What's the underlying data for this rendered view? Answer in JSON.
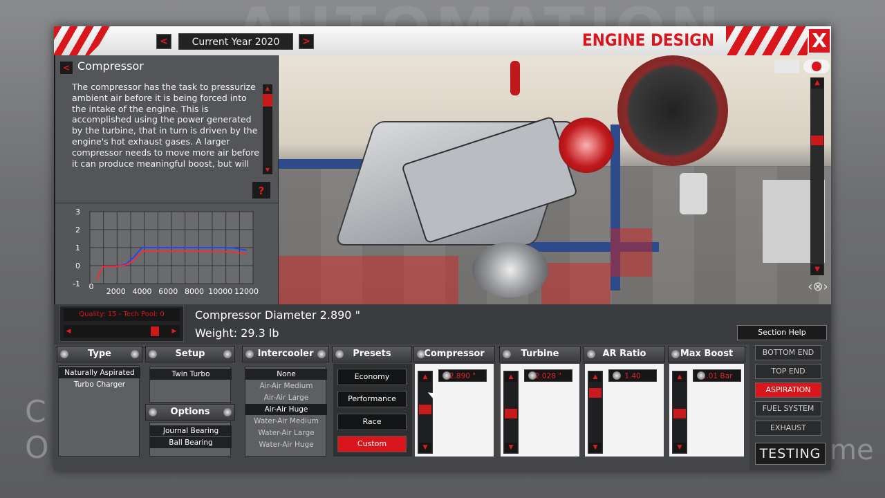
{
  "backdrop": {
    "title": "AUTOMATION",
    "left_text": "C\nO",
    "right_text": "me"
  },
  "header": {
    "year_label": "Current Year 2020",
    "prev_year": "<",
    "next_year": ">",
    "title": "ENGINE DESIGN",
    "close": "X"
  },
  "info": {
    "back": "<",
    "heading": "Compressor",
    "text": "The compressor has the task to pressurize ambient air before it is being forced into the intake of the engine. This is accomplished using the power generated by the turbine, that in turn is driven by the engine's hot exhaust gases. A larger compressor needs to move more air before it can produce meaningful boost, but will",
    "help": "?"
  },
  "chart_data": {
    "type": "line",
    "title": "",
    "xlabel": "",
    "ylabel": "",
    "x_ticks": [
      "2000",
      "4000",
      "6000",
      "8000",
      "10000",
      "12000"
    ],
    "y_ticks": [
      "3",
      "2",
      "1",
      "0",
      "-1"
    ],
    "x_origin_label": "0",
    "xlim": [
      0,
      12500
    ],
    "ylim": [
      -1,
      3
    ],
    "series": [
      {
        "color": "#2040ff",
        "x": [
          500,
          1000,
          2000,
          2800,
          3400,
          4000,
          6000,
          8000,
          10000,
          11000,
          12000
        ],
        "y": [
          -0.8,
          -0.05,
          -0.05,
          0.1,
          0.5,
          1.0,
          1.0,
          1.0,
          1.0,
          0.98,
          0.85
        ]
      },
      {
        "color": "#ff2a2a",
        "x": [
          500,
          1000,
          2000,
          2800,
          3400,
          4000,
          6000,
          8000,
          10000,
          11000,
          12000
        ],
        "y": [
          -0.8,
          -0.05,
          -0.05,
          0.05,
          0.3,
          0.8,
          0.8,
          0.8,
          0.78,
          0.75,
          0.65
        ]
      }
    ]
  },
  "status": {
    "quality": "Quality: 15 - Tech Pool: 0",
    "quality_slider": 0.9,
    "prop_name": "Compressor Diameter 2.890 \"",
    "prop_weight": "Weight: 29.3 lb",
    "section_help": "Section Help"
  },
  "panels": {
    "type": {
      "title": "Type",
      "options": [
        "Naturally Aspirated",
        "Turbo Charger"
      ],
      "selected": "Naturally Aspirated"
    },
    "setup": {
      "title": "Setup",
      "options": [
        "Twin Turbo"
      ]
    },
    "options": {
      "title": "Options",
      "options": [
        "Journal Bearing",
        "Ball Bearing"
      ]
    },
    "intercooler": {
      "title": "Intercooler",
      "options": [
        "None",
        "Air-Air Medium",
        "Air-Air Large",
        "Air-Air Huge",
        "Water-Air Medium",
        "Water-Air Large",
        "Water-Air Huge"
      ]
    },
    "presets": {
      "title": "Presets",
      "options": [
        "Economy",
        "Performance",
        "Race",
        "Custom"
      ],
      "active": "Custom"
    },
    "compressor": {
      "title": "Compressor",
      "value": "2.890 \"",
      "level": 0.55
    },
    "turbine": {
      "title": "Turbine",
      "value": "2.028 \"",
      "level": 0.45
    },
    "ar_ratio": {
      "title": "AR Ratio",
      "value": "1.40",
      "level": 0.92
    },
    "max_boost": {
      "title": "Max Boost",
      "value": "1.01 Bar",
      "level": 0.45
    }
  },
  "side_nav": {
    "items": [
      "BOTTOM END",
      "TOP END",
      "ASPIRATION",
      "FUEL SYSTEM",
      "EXHAUST"
    ],
    "active": "ASPIRATION",
    "testing": "TESTING"
  },
  "colors": {
    "accent": "#d8161b",
    "panel": "#444548"
  }
}
